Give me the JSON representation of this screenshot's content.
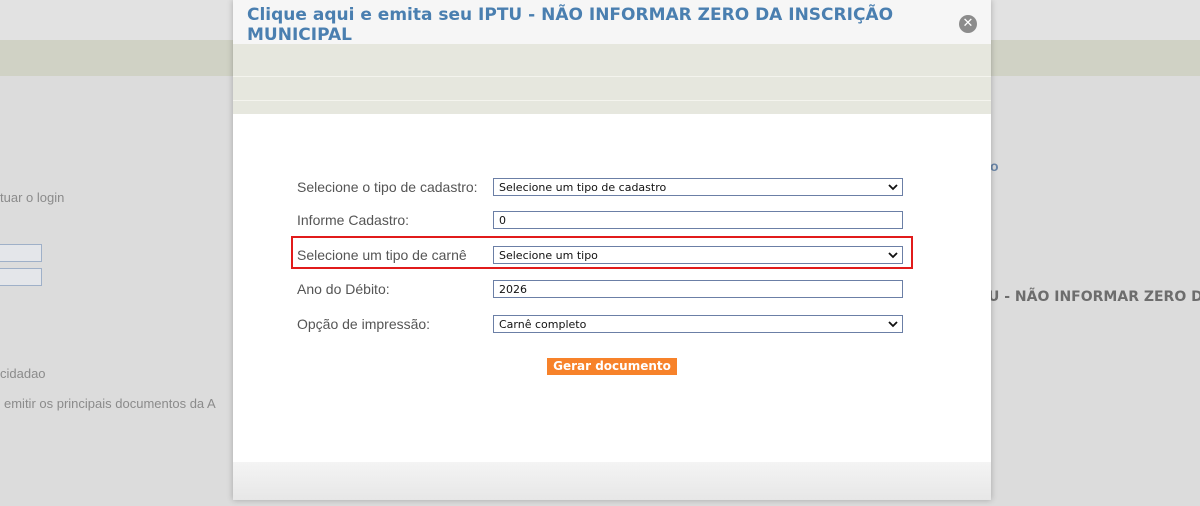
{
  "background": {
    "login_hint": "tuar o login",
    "cidadao_label": "cidadao",
    "documents_text": "emitir os principais documentos da A",
    "right_link": "o",
    "right_title": "U - NÃO INFORMAR ZERO D"
  },
  "modal": {
    "title": "Clique aqui e emita seu IPTU - NÃO INFORMAR ZERO DA INSCRIÇÃO MUNICIPAL",
    "close_symbol": "✕"
  },
  "form": {
    "tipo_cadastro": {
      "label": "Selecione o tipo de cadastro:",
      "value": "Selecione um tipo de cadastro"
    },
    "cadastro": {
      "label": "Informe Cadastro:",
      "value": "0"
    },
    "tipo_carne": {
      "label": "Selecione um tipo de carnê",
      "value": "Selecione um tipo"
    },
    "ano_debito": {
      "label": "Ano do Débito:",
      "value": "2026"
    },
    "opcao_impressao": {
      "label": "Opção de impressão:",
      "value": "Carnê completo"
    },
    "submit_label": "Gerar documento"
  },
  "colors": {
    "title": "#4a7fb0",
    "highlight": "#e11b1b",
    "button": "#f7822a"
  },
  "icons": {
    "close": "close-icon",
    "dropdown": "chevron-down-icon"
  }
}
